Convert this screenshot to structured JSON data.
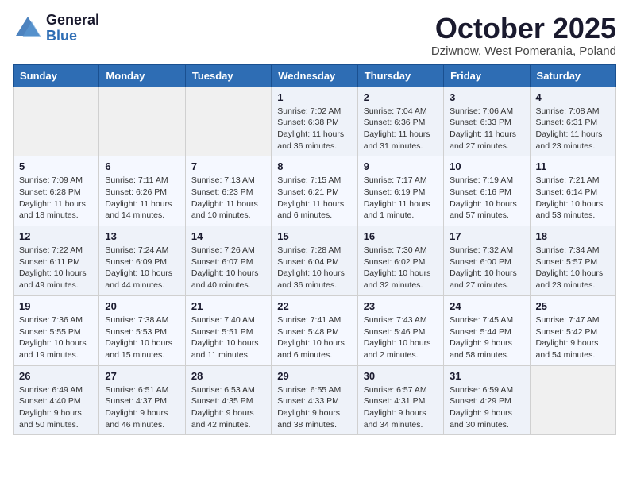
{
  "logo": {
    "general": "General",
    "blue": "Blue"
  },
  "title": "October 2025",
  "subtitle": "Dziwnow, West Pomerania, Poland",
  "days_of_week": [
    "Sunday",
    "Monday",
    "Tuesday",
    "Wednesday",
    "Thursday",
    "Friday",
    "Saturday"
  ],
  "weeks": [
    [
      {
        "day": "",
        "info": ""
      },
      {
        "day": "",
        "info": ""
      },
      {
        "day": "",
        "info": ""
      },
      {
        "day": "1",
        "info": "Sunrise: 7:02 AM\nSunset: 6:38 PM\nDaylight: 11 hours\nand 36 minutes."
      },
      {
        "day": "2",
        "info": "Sunrise: 7:04 AM\nSunset: 6:36 PM\nDaylight: 11 hours\nand 31 minutes."
      },
      {
        "day": "3",
        "info": "Sunrise: 7:06 AM\nSunset: 6:33 PM\nDaylight: 11 hours\nand 27 minutes."
      },
      {
        "day": "4",
        "info": "Sunrise: 7:08 AM\nSunset: 6:31 PM\nDaylight: 11 hours\nand 23 minutes."
      }
    ],
    [
      {
        "day": "5",
        "info": "Sunrise: 7:09 AM\nSunset: 6:28 PM\nDaylight: 11 hours\nand 18 minutes."
      },
      {
        "day": "6",
        "info": "Sunrise: 7:11 AM\nSunset: 6:26 PM\nDaylight: 11 hours\nand 14 minutes."
      },
      {
        "day": "7",
        "info": "Sunrise: 7:13 AM\nSunset: 6:23 PM\nDaylight: 11 hours\nand 10 minutes."
      },
      {
        "day": "8",
        "info": "Sunrise: 7:15 AM\nSunset: 6:21 PM\nDaylight: 11 hours\nand 6 minutes."
      },
      {
        "day": "9",
        "info": "Sunrise: 7:17 AM\nSunset: 6:19 PM\nDaylight: 11 hours\nand 1 minute."
      },
      {
        "day": "10",
        "info": "Sunrise: 7:19 AM\nSunset: 6:16 PM\nDaylight: 10 hours\nand 57 minutes."
      },
      {
        "day": "11",
        "info": "Sunrise: 7:21 AM\nSunset: 6:14 PM\nDaylight: 10 hours\nand 53 minutes."
      }
    ],
    [
      {
        "day": "12",
        "info": "Sunrise: 7:22 AM\nSunset: 6:11 PM\nDaylight: 10 hours\nand 49 minutes."
      },
      {
        "day": "13",
        "info": "Sunrise: 7:24 AM\nSunset: 6:09 PM\nDaylight: 10 hours\nand 44 minutes."
      },
      {
        "day": "14",
        "info": "Sunrise: 7:26 AM\nSunset: 6:07 PM\nDaylight: 10 hours\nand 40 minutes."
      },
      {
        "day": "15",
        "info": "Sunrise: 7:28 AM\nSunset: 6:04 PM\nDaylight: 10 hours\nand 36 minutes."
      },
      {
        "day": "16",
        "info": "Sunrise: 7:30 AM\nSunset: 6:02 PM\nDaylight: 10 hours\nand 32 minutes."
      },
      {
        "day": "17",
        "info": "Sunrise: 7:32 AM\nSunset: 6:00 PM\nDaylight: 10 hours\nand 27 minutes."
      },
      {
        "day": "18",
        "info": "Sunrise: 7:34 AM\nSunset: 5:57 PM\nDaylight: 10 hours\nand 23 minutes."
      }
    ],
    [
      {
        "day": "19",
        "info": "Sunrise: 7:36 AM\nSunset: 5:55 PM\nDaylight: 10 hours\nand 19 minutes."
      },
      {
        "day": "20",
        "info": "Sunrise: 7:38 AM\nSunset: 5:53 PM\nDaylight: 10 hours\nand 15 minutes."
      },
      {
        "day": "21",
        "info": "Sunrise: 7:40 AM\nSunset: 5:51 PM\nDaylight: 10 hours\nand 11 minutes."
      },
      {
        "day": "22",
        "info": "Sunrise: 7:41 AM\nSunset: 5:48 PM\nDaylight: 10 hours\nand 6 minutes."
      },
      {
        "day": "23",
        "info": "Sunrise: 7:43 AM\nSunset: 5:46 PM\nDaylight: 10 hours\nand 2 minutes."
      },
      {
        "day": "24",
        "info": "Sunrise: 7:45 AM\nSunset: 5:44 PM\nDaylight: 9 hours\nand 58 minutes."
      },
      {
        "day": "25",
        "info": "Sunrise: 7:47 AM\nSunset: 5:42 PM\nDaylight: 9 hours\nand 54 minutes."
      }
    ],
    [
      {
        "day": "26",
        "info": "Sunrise: 6:49 AM\nSunset: 4:40 PM\nDaylight: 9 hours\nand 50 minutes."
      },
      {
        "day": "27",
        "info": "Sunrise: 6:51 AM\nSunset: 4:37 PM\nDaylight: 9 hours\nand 46 minutes."
      },
      {
        "day": "28",
        "info": "Sunrise: 6:53 AM\nSunset: 4:35 PM\nDaylight: 9 hours\nand 42 minutes."
      },
      {
        "day": "29",
        "info": "Sunrise: 6:55 AM\nSunset: 4:33 PM\nDaylight: 9 hours\nand 38 minutes."
      },
      {
        "day": "30",
        "info": "Sunrise: 6:57 AM\nSunset: 4:31 PM\nDaylight: 9 hours\nand 34 minutes."
      },
      {
        "day": "31",
        "info": "Sunrise: 6:59 AM\nSunset: 4:29 PM\nDaylight: 9 hours\nand 30 minutes."
      },
      {
        "day": "",
        "info": ""
      }
    ]
  ]
}
